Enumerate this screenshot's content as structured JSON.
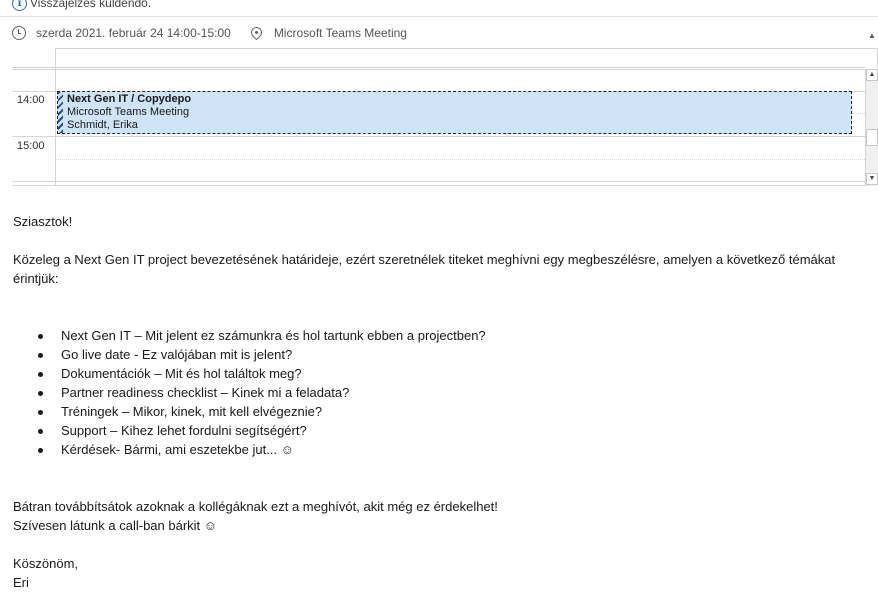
{
  "notice": {
    "text": "Visszajelzés küldendő."
  },
  "meeting": {
    "datetime": "szerda 2021. február 24 14:00-15:00",
    "location": "Microsoft Teams Meeting"
  },
  "calendar": {
    "times": [
      "14:00",
      "15:00"
    ],
    "event": {
      "title": "Next Gen IT / Copydepo",
      "location": "Microsoft Teams Meeting",
      "organizer": "Schmidt, Erika"
    }
  },
  "message": {
    "greeting": "Sziasztok!",
    "intro": "Közeleg a Next Gen IT project bevezetésének határideje, ezért szeretnélek titeket meghívni egy megbeszélésre, amelyen a következő témákat érintjük:",
    "topics": [
      "Next Gen IT – Mit jelent ez számunkra és hol tartunk ebben a projectben?",
      "Go live date - Ez valójában mit is jelent?",
      "Dokumentációk – Mit és hol találtok meg?",
      "Partner readiness checklist – Kinek mi a feladata?",
      "Tréningek – Mikor, kinek, mit kell elvégeznie?",
      "Support – Kihez lehet fordulni segítségért?",
      "Kérdések- Bármi, ami eszetekbe jut... ☺"
    ],
    "closing_1": "Bátran továbbítsátok azoknak a kollégáknak ezt a meghívót, akit még ez érdekelhet!",
    "closing_2": "Szívesen látunk a call-ban bárkit ☺",
    "thanks": "Köszönöm,",
    "signature": "Eri"
  }
}
